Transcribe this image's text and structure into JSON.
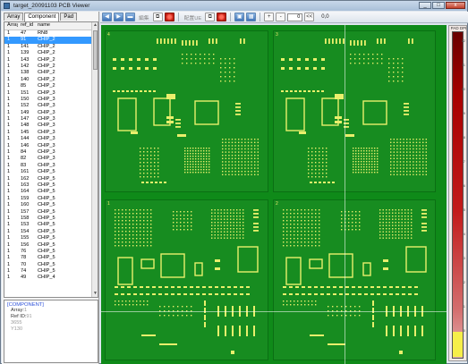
{
  "window": {
    "title": "target_20091103 PCB Viewer",
    "minimize": "_",
    "maximize": "□",
    "close": "x"
  },
  "tabs": [
    {
      "label": "Array"
    },
    {
      "label": "Component",
      "active": true
    },
    {
      "label": "Pad"
    }
  ],
  "grid": {
    "columns": [
      "Array",
      "ref_id",
      "name"
    ],
    "rows": [
      [
        "1",
        "47",
        "RN8"
      ],
      [
        "1",
        "91",
        "CHIP_2"
      ],
      [
        "1",
        "141",
        "CHIP_2"
      ],
      [
        "1",
        "139",
        "CHIP_2"
      ],
      [
        "1",
        "143",
        "CHIP_2"
      ],
      [
        "1",
        "142",
        "CHIP_2"
      ],
      [
        "1",
        "138",
        "CHIP_2"
      ],
      [
        "1",
        "140",
        "CHIP_2"
      ],
      [
        "1",
        "85",
        "CHIP_2"
      ],
      [
        "1",
        "151",
        "CHIP_3"
      ],
      [
        "1",
        "150",
        "CHIP_3"
      ],
      [
        "1",
        "152",
        "CHIP_3"
      ],
      [
        "1",
        "149",
        "CHIP_3"
      ],
      [
        "1",
        "147",
        "CHIP_3"
      ],
      [
        "1",
        "148",
        "CHIP_3"
      ],
      [
        "1",
        "145",
        "CHIP_3"
      ],
      [
        "1",
        "144",
        "CHIP_3"
      ],
      [
        "1",
        "146",
        "CHIP_3"
      ],
      [
        "1",
        "84",
        "CHIP_3"
      ],
      [
        "1",
        "82",
        "CHIP_3"
      ],
      [
        "1",
        "83",
        "CHIP_3"
      ],
      [
        "1",
        "161",
        "CHIP_5"
      ],
      [
        "1",
        "162",
        "CHIP_5"
      ],
      [
        "1",
        "163",
        "CHIP_5"
      ],
      [
        "1",
        "164",
        "CHIP_5"
      ],
      [
        "1",
        "159",
        "CHIP_5"
      ],
      [
        "1",
        "160",
        "CHIP_5"
      ],
      [
        "1",
        "157",
        "CHIP_5"
      ],
      [
        "1",
        "158",
        "CHIP_5"
      ],
      [
        "1",
        "153",
        "CHIP_5"
      ],
      [
        "1",
        "154",
        "CHIP_5"
      ],
      [
        "1",
        "155",
        "CHIP_5"
      ],
      [
        "1",
        "156",
        "CHIP_5"
      ],
      [
        "1",
        "76",
        "CHIP_5"
      ],
      [
        "1",
        "78",
        "CHIP_5"
      ],
      [
        "1",
        "70",
        "CHIP_5"
      ],
      [
        "1",
        "74",
        "CHIP_5"
      ],
      [
        "1",
        "49",
        "CHIP_4"
      ]
    ],
    "selected_index": 1
  },
  "info": {
    "title": "[COMPONENT]",
    "lines": [
      {
        "label": "Array",
        "value": "1"
      },
      {
        "label": "Ref ID",
        "value": "91"
      },
      {
        "label": "",
        "value": "3655"
      },
      {
        "label": "",
        "value": "Y130"
      }
    ]
  },
  "toolbar": {
    "label1": "編集",
    "label2": "配置UE",
    "input_value": "0",
    "coord": "0,0",
    "btn_plus": "+",
    "btn_minus": "-",
    "btn_back": "<<"
  },
  "boards": [
    {
      "num": "4"
    },
    {
      "num": "3"
    },
    {
      "num": "1"
    },
    {
      "num": "2"
    }
  ],
  "colorbar": {
    "title": "PAD DPI",
    "ticks": [
      "12",
      "11",
      "10",
      "9",
      "8",
      "7",
      "6",
      "5",
      "4",
      "3",
      "2",
      "1",
      "0"
    ]
  },
  "colors": {
    "board_green": "#178c20",
    "pad_yellow": "#e9ef6c",
    "selection": "#3399ff"
  }
}
